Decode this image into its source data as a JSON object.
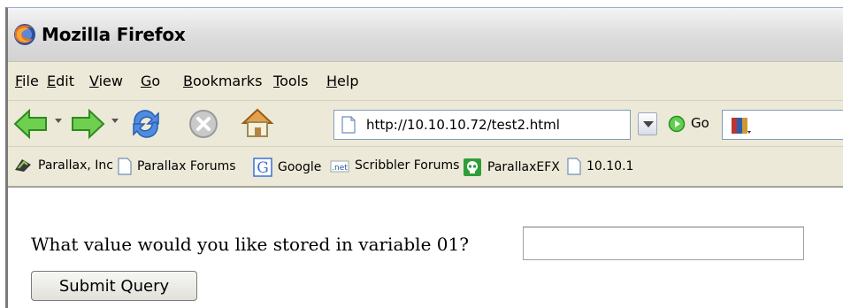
{
  "window": {
    "title": "Mozilla Firefox"
  },
  "menu": {
    "items": [
      {
        "accel": "F",
        "rest": "ile"
      },
      {
        "accel": "E",
        "rest": "dit"
      },
      {
        "accel": "V",
        "rest": "iew"
      },
      {
        "accel": "G",
        "rest": "o"
      },
      {
        "accel": "B",
        "rest": "ookmarks"
      },
      {
        "accel": "T",
        "rest": "ools"
      },
      {
        "accel": "H",
        "rest": "elp"
      }
    ]
  },
  "navigation": {
    "url": "http://10.10.10.72/test2.html",
    "go_label": "Go"
  },
  "bookmarks": [
    {
      "label": "Parallax, Inc",
      "icon": "parallax-icon"
    },
    {
      "label": "Parallax Forums",
      "icon": "page-icon"
    },
    {
      "label": "Google",
      "icon": "google-icon"
    },
    {
      "label": "Scribbler Forums",
      "icon": "net-icon"
    },
    {
      "label": "ParallaxEFX",
      "icon": "skull-icon"
    },
    {
      "label": "10.10.1",
      "icon": "page-icon"
    }
  ],
  "page": {
    "question": "What value would you like stored in variable 01?",
    "input_value": "",
    "submit_label": "Submit Query"
  }
}
